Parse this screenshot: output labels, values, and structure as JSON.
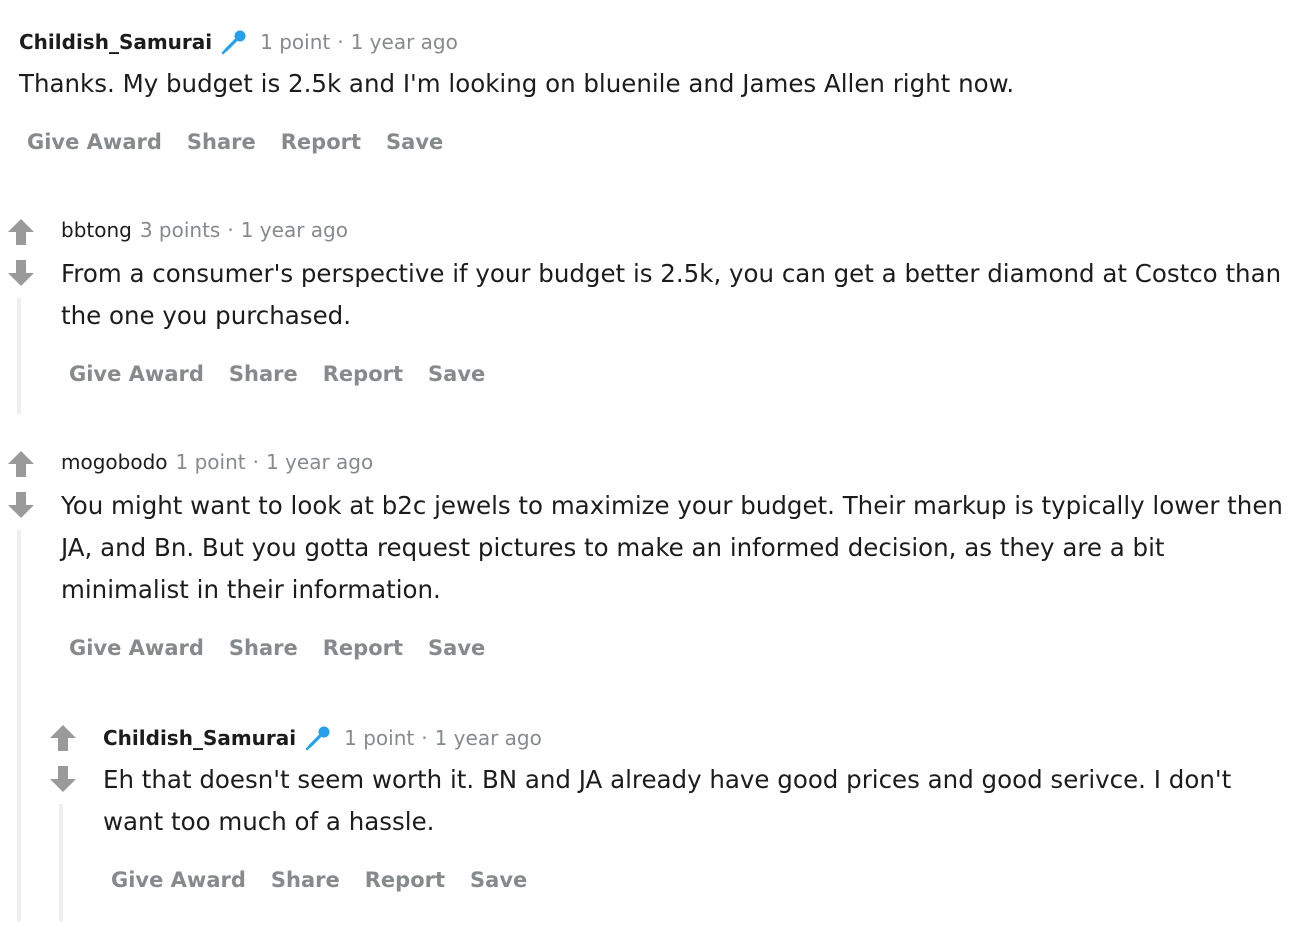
{
  "comments": [
    {
      "username": "Childish_Samurai",
      "points": "1 point",
      "separator": "·",
      "time": "1 year ago",
      "body": "Thanks. My budget is 2.5k and I'm looking on bluenile and James Allen right now."
    },
    {
      "username": "bbtong",
      "points": "3 points",
      "separator": "·",
      "time": "1 year ago",
      "body": "From a consumer's perspective if your budget is 2.5k, you can get a better diamond at Costco than the one you purchased."
    },
    {
      "username": "mogobodo",
      "points": "1 point",
      "separator": "·",
      "time": "1 year ago",
      "body": "You might want to look at b2c jewels to maximize your budget. Their markup is typically lower then JA, and Bn. But you gotta request pictures to make an informed decision, as they are a bit minimalist in their information."
    },
    {
      "username": "Childish_Samurai",
      "points": "1 point",
      "separator": "·",
      "time": "1 year ago",
      "body": "Eh that doesn't seem worth it. BN and JA already have good prices and good serivce. I don't want too much of a hassle."
    }
  ],
  "actions": {
    "give_award": "Give Award",
    "share": "Share",
    "report": "Report",
    "save": "Save"
  },
  "icons": {
    "flair": "microphone-icon",
    "upvote": "upvote-arrow-icon",
    "downvote": "downvote-arrow-icon"
  },
  "colors": {
    "meta_gray": "#878a8c",
    "flair_blue": "#24a0ed",
    "thread_line": "#edeff1",
    "vote_arrow": "#9a9a9a"
  }
}
